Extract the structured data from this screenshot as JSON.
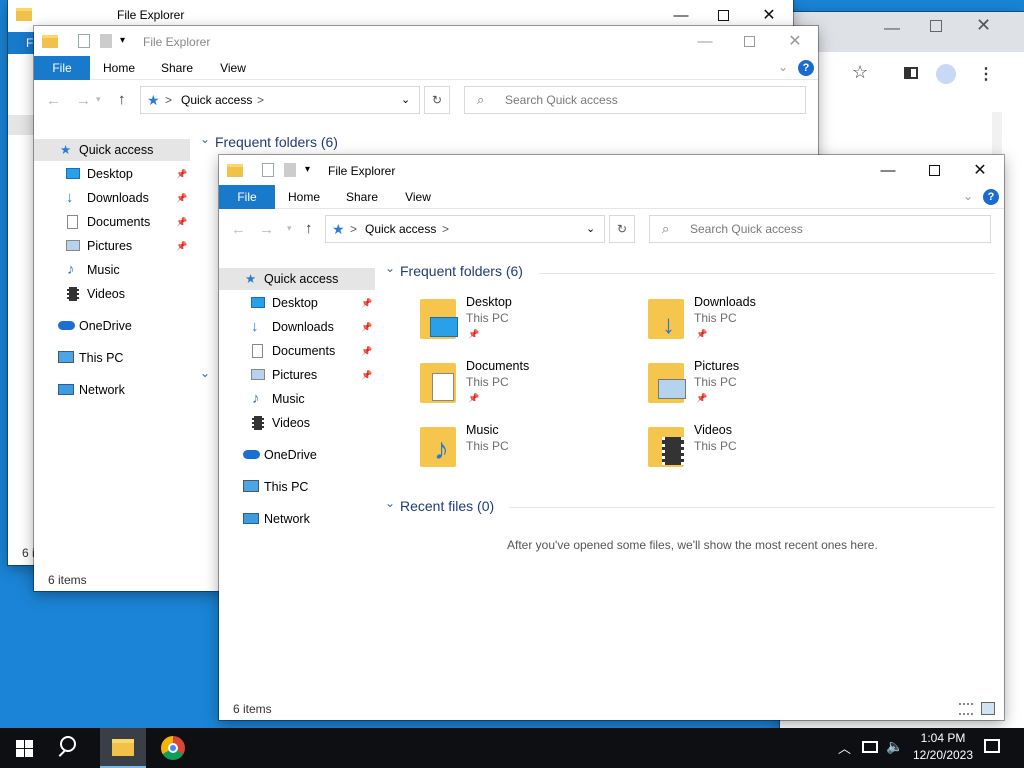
{
  "app_title": "File Explorer",
  "ribbon": {
    "file": "File",
    "home": "Home",
    "share": "Share",
    "view": "View",
    "help": "?"
  },
  "address": {
    "location": "Quick access",
    "chev": ">"
  },
  "search": {
    "placeholder": "Search Quick access"
  },
  "nav": {
    "quick_access": "Quick access",
    "desktop": "Desktop",
    "downloads": "Downloads",
    "documents": "Documents",
    "pictures": "Pictures",
    "music": "Music",
    "videos": "Videos",
    "onedrive": "OneDrive",
    "this_pc": "This PC",
    "network": "Network"
  },
  "main": {
    "frequent_header": "Frequent folders (6)",
    "recent_header": "Recent files (0)",
    "recent_empty": "After you've opened some files, we'll show the most recent ones here.",
    "folders": [
      {
        "name": "Desktop",
        "sub": "This PC",
        "pinned": true,
        "icon": "desktop-folder-icon"
      },
      {
        "name": "Downloads",
        "sub": "This PC",
        "pinned": true,
        "icon": "downloads-folder-icon"
      },
      {
        "name": "Documents",
        "sub": "This PC",
        "pinned": true,
        "icon": "documents-folder-icon"
      },
      {
        "name": "Pictures",
        "sub": "This PC",
        "pinned": true,
        "icon": "pictures-folder-icon"
      },
      {
        "name": "Music",
        "sub": "This PC",
        "pinned": false,
        "icon": "music-folder-icon"
      },
      {
        "name": "Videos",
        "sub": "This PC",
        "pinned": false,
        "icon": "videos-folder-icon"
      }
    ]
  },
  "status": {
    "items": "6 items",
    "items_clip": "6 i"
  },
  "back": {
    "ribbon_clip": "F"
  },
  "taskbar": {
    "time": "1:04 PM",
    "date": "12/20/2023"
  },
  "colors": {
    "accent": "#1979ca",
    "folder": "#f5c54e",
    "desktop_bg": "#1b84d6",
    "taskbar": "#0e0f12"
  }
}
